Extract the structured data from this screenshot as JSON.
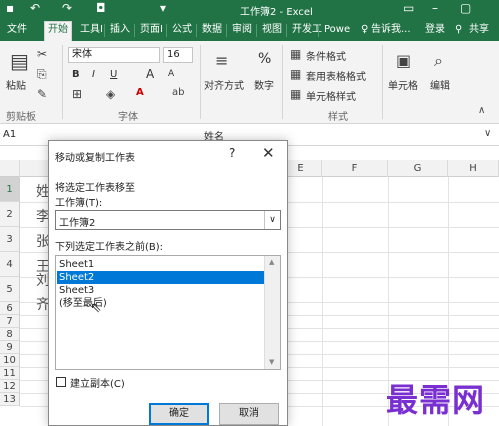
{
  "titlebar": {
    "title": "工作簿2 - Excel"
  },
  "tabs": [
    "文件",
    "开始",
    "工具I",
    "插入",
    "页面I",
    "公式",
    "数据",
    "审阅",
    "视图",
    "开发工",
    "Powe"
  ],
  "tell_me": "告诉我...",
  "login": "登录",
  "share": "共享",
  "ribbon": {
    "paste": "粘贴",
    "clipboard": "剪贴板",
    "font_name": "宋体",
    "font_size": "16",
    "bold": "B",
    "italic": "I",
    "underline": "U",
    "grow": "A",
    "shrink": "A",
    "font_color": "A",
    "font_group": "字体",
    "align": "对齐方式",
    "number": "数字",
    "percent": "%",
    "cond_format": "条件格式",
    "table_format": "套用表格格式",
    "cell_style": "单元格样式",
    "styles": "样式",
    "cells": "单元格",
    "edit": "编辑"
  },
  "formula_bar": {
    "name_box": "A1",
    "content": "姓名"
  },
  "sheet": {
    "columns": [
      "E",
      "F",
      "G",
      "H"
    ],
    "rows": [
      "1",
      "2",
      "3",
      "4",
      "5",
      "6",
      "7",
      "8",
      "9",
      "10",
      "11",
      "12",
      "13"
    ],
    "cells": [
      "姓",
      "李",
      "张",
      "王",
      "刘",
      "齐"
    ]
  },
  "dialog": {
    "title": "移动或复制工作表",
    "help": "?",
    "close": "✕",
    "move_to_label": "将选定工作表移至",
    "workbook_label": "工作簿(T):",
    "workbook_value": "工作簿2",
    "before_label": "下列选定工作表之前(B):",
    "sheets": [
      "Sheet1",
      "Sheet2",
      "Sheet3",
      "(移至最后)"
    ],
    "selected_index": 1,
    "copy_label": "建立副本(C)",
    "ok": "确定",
    "cancel": "取消"
  },
  "watermark": "最需网",
  "colors": {
    "excel_green": "#217346",
    "selection_blue": "#0078d7",
    "watermark_purple": "#7a2fd0"
  }
}
